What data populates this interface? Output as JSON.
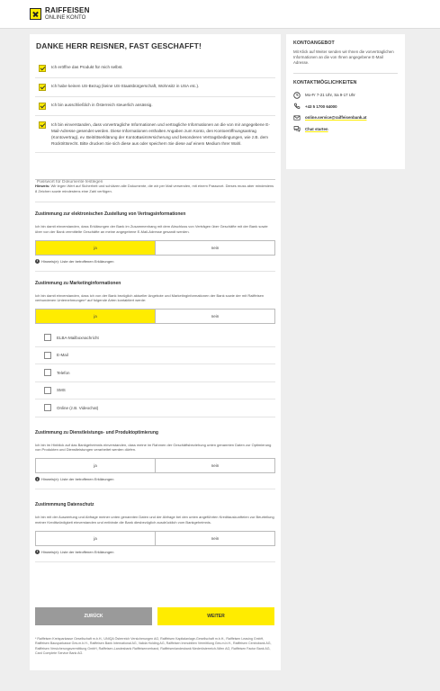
{
  "header": {
    "logo_name": "RAIFFEISEN",
    "logo_sub": "ONLINE KONTO",
    "accent_color": "#ffec00"
  },
  "main": {
    "title": "DANKE HERR REISNER, FAST GESCHAFFT!",
    "checks": [
      {
        "label": "Ich eröffne das Produkt für mich selbst.",
        "checked": true
      },
      {
        "label": "Ich habe keinen US-Bezug (keine US-Staatsbürgerschaft, Wohnsitz in USA etc.).",
        "checked": true
      },
      {
        "label": "Ich bin ausschließlich in Österreich steuerlich ansässig.",
        "checked": true
      },
      {
        "label": "Ich bin einverstanden, dass vorvertragliche Informationen und vertragliche Informationen an die von mir angegebene E-Mail-Adresse gesendet werden. Diese Informationen enthalten Angaben zum Konto, den Kontoeröffnungsantrag (Kontovertrag), ev. Beitrittserklärung der KontoBasisVersicherung und besonderen Vertragsbedingungen, wie z.B. dem Rücktrittsrecht. Bitte drucken Sie sich diese aus oder speichern Sie diese auf einem Medium Ihrer Wahl.",
        "checked": true
      }
    ],
    "password_placeholder": "Passwort für Dokumente festlegen",
    "note_label": "Hinweis:",
    "note_text": " Wir legen Wert auf Sicherheit und schützen alle Dokumente, die wir per Mail versenden, mit einem Passwort. Dieses muss aber mindestens 8 Zeichen sowie mindestens eine Zahl verfügen.",
    "hint_label": "Hinweis(e): Liste der betroffenen Erklärungen",
    "sections": {
      "s1": {
        "title": "Zustimmung zur elektronischen Zustellung von Vertragsinformationen",
        "text": "Ich bin damit einverstanden, dass Erklärungen der Bank im Zusammenhang mit dem Abschluss von Verträgen über Geschäfte mit der Bank sowie über von der Bank vermittelte Geschäfte an meine angegebene E-Mail-Adresse gesandt werden.",
        "yes": "ja",
        "no": "nein",
        "selected": "ja"
      },
      "s2": {
        "title": "Zustimmung zu Marketinginformationen",
        "text": "Ich bin damit einverstanden, dass ich von der Bank bezüglich aktueller Angebote und Marketinginformationen der Bank sowie der mit Raiffeisen verbundenen Unternehmungen* auf folgende Arten kontaktiert werde:",
        "yes": "ja",
        "no": "nein",
        "selected": "ja",
        "options": [
          "ELBA-Mailboxnachricht",
          "E-Mail",
          "Telefon",
          "SMS",
          "Online (z.B. Videochat)"
        ]
      },
      "s3": {
        "title": "Zustimmung zu Dienstleistungs- und Produktoptimierung",
        "text": "Ich bin im Hinblick auf das Bankgeheimnis einverstanden, dass meine im Rahmen der Geschäftsbeziehung unten genannten Daten zur Optimierung von Produkten und Dienstleistungen verarbeitet werden dürfen.",
        "yes": "ja",
        "no": "nein",
        "selected": ""
      },
      "s4": {
        "title": "Zustimmmung Datenschutz",
        "text": "Ich bin mit der Auswertung und Abfrage meiner unten genannten Daten und der Abfrage bei den unten angeführten Kreditauskunfteien zur Beurteilung meiner Kreditwürdigkeit einverstanden und entbinde die Bank diesbezüglich ausdrücklich vom Bankgeheimnis.",
        "yes": "ja",
        "no": "nein",
        "selected": ""
      }
    },
    "back_label": "ZURÜCK",
    "next_label": "WEITER",
    "footnote": "* Raiffeisen Kreisparkasse Gesellschaft m.b.H., UNIQA Österreich Versicherungen AG, Raiffeisen Kapitalanlage-Gesellschaft m.b.H., Raiffeisen Leasing GmbH, Raiffeisen Bausparkasse Ges.m.b.H., Raiffeisen Bank International AG, Valida Holding AG, Raiffeisen Immobilien Vermittlung Ges.m.b.H., Raiffeisen Centrobank AG, Raiffeisen Versicherungsvermittlung GmbH, Raiffeisen-Landesbank Raiffeisenverband, Raiffeisenlandesbank Niederösterreich-Wien AG, Raiffeisen Factor Bank AG, Card Complete Service Bank AG."
  },
  "sidebar": {
    "offer_title": "KONTOANGEBOT",
    "offer_text": "Mit Klick auf Weiter senden wir Ihnen die vorvertraglichen Informationen an die von Ihnen angegebene E-Mail Adresse.",
    "contact_title": "KONTAKTMÖGLICHKEITEN",
    "hours": "Mo-Fr 7-21 Uhr, Sa 9-17 Uhr",
    "phone": "+43 5 1700 64000",
    "email": "online.service@raiffeisenbank.at",
    "chat": "Chat starten"
  }
}
